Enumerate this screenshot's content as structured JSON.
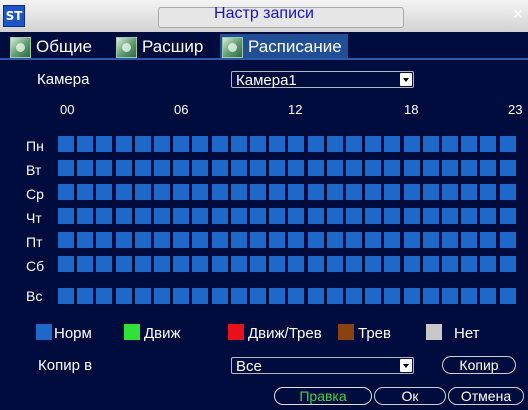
{
  "window": {
    "title": "Настр записи",
    "logo_text": "ST",
    "close_glyph": "×"
  },
  "tabs": [
    {
      "label": "Общие",
      "active": false
    },
    {
      "label": "Расшир",
      "active": false
    },
    {
      "label": "Расписание",
      "active": true
    }
  ],
  "camera": {
    "label": "Камера",
    "value": "Камера1"
  },
  "schedule": {
    "hour_labels": [
      "00",
      "06",
      "12",
      "18",
      "23"
    ],
    "days": [
      "Пн",
      "Вт",
      "Ср",
      "Чт",
      "Пт",
      "Сб",
      "Вс"
    ],
    "hours_count": 24,
    "cells_mode": "Норм"
  },
  "legend": [
    {
      "label": "Норм",
      "color": "#1d68c9"
    },
    {
      "label": "Движ",
      "color": "#2ee23a"
    },
    {
      "label": "Движ/Трев",
      "color": "#e8101a"
    },
    {
      "label": "Трев",
      "color": "#8a4210"
    },
    {
      "label": "Нет",
      "color": "#c8c8c8"
    }
  ],
  "copy": {
    "label": "Копир в",
    "value": "Все",
    "button": "Копир"
  },
  "footer": {
    "edit": "Правка",
    "ok": "Ок",
    "cancel": "Отмена"
  }
}
